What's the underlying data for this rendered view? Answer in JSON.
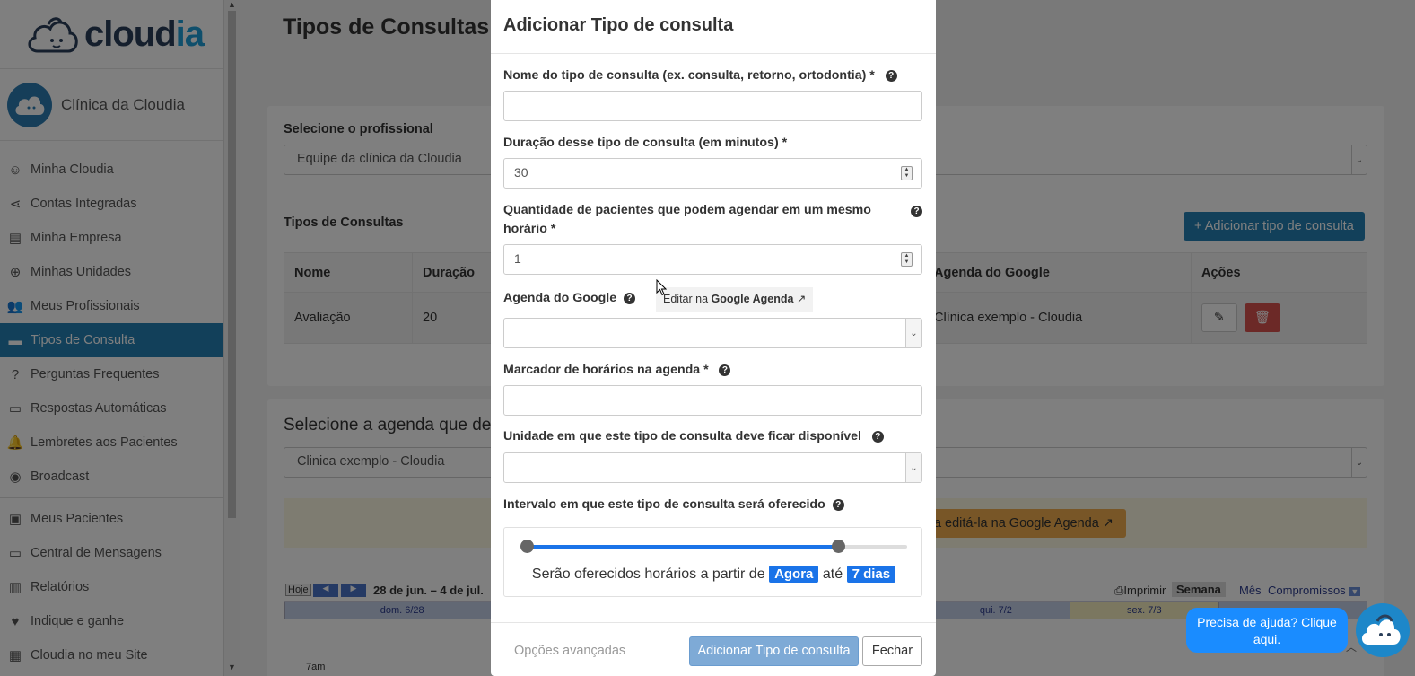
{
  "brand": {
    "name_a": "cloud",
    "name_b": "ia"
  },
  "clinic": {
    "name": "Clínica da Cloudia"
  },
  "sidebar": {
    "items": [
      {
        "label": "Minha Cloudia",
        "icon": "face-icon"
      },
      {
        "label": "Contas Integradas",
        "icon": "share-icon"
      },
      {
        "label": "Minha Empresa",
        "icon": "store-icon"
      },
      {
        "label": "Minhas Unidades",
        "icon": "plus-circle-icon"
      },
      {
        "label": "Meus Profissionais",
        "icon": "people-icon"
      },
      {
        "label": "Tipos de Consulta",
        "icon": "list-icon"
      },
      {
        "label": "Perguntas Frequentes",
        "icon": "question-icon"
      },
      {
        "label": "Respostas Automáticas",
        "icon": "chat-icon"
      },
      {
        "label": "Lembretes aos Pacientes",
        "icon": "bell-icon"
      },
      {
        "label": "Broadcast",
        "icon": "broadcast-icon"
      },
      {
        "label": "Meus Pacientes",
        "icon": "contacts-icon"
      },
      {
        "label": "Central de Mensagens",
        "icon": "message-icon"
      },
      {
        "label": "Relatórios",
        "icon": "bar-chart-icon"
      },
      {
        "label": "Indique e ganhe",
        "icon": "heart-icon"
      },
      {
        "label": "Cloudia no meu Site",
        "icon": "widgets-icon"
      }
    ]
  },
  "main": {
    "title": "Tipos de Consultas",
    "select_professional_label": "Selecione o profissional",
    "select_professional_value": "Equipe da clínica da Cloudia",
    "types_label": "Tipos de Consultas",
    "add_type_button": "Adicionar tipo de consulta",
    "table": {
      "headers": [
        "Nome",
        "Duração",
        "Agenda do Google",
        "Ações"
      ],
      "rows": [
        {
          "nome": "Avaliação",
          "duracao": "20",
          "agenda": "Clínica exemplo - Cloudia"
        }
      ]
    },
    "select_agenda_label": "Selecione a agenda que dese",
    "select_agenda_value": "Clinica exemplo - Cloudia",
    "warn_button": "para editá-la na Google Agenda",
    "calendar": {
      "today": "Hoje",
      "range": "28 de jun. – 4 de jul.",
      "print": "Imprimir",
      "week": "Semana",
      "month": "Mês",
      "appointments": "Compromissos",
      "days": [
        "dom. 6/28",
        "",
        "",
        "",
        "qui. 7/2",
        "sex. 7/3",
        ""
      ],
      "time": "7am"
    }
  },
  "modal": {
    "title": "Adicionar Tipo de consulta",
    "name_label": "Nome do tipo de consulta (ex. consulta, retorno, ortodontia) *",
    "name_value": "",
    "duration_label": "Duração desse tipo de consulta (em minutos) *",
    "duration_value": "30",
    "quantity_label_1": "Quantidade de pacientes que podem agendar em um mesmo",
    "quantity_label_2": "horário *",
    "quantity_value": "1",
    "gcal_label": "Agenda do Google",
    "gcal_link_pre": "Editar na ",
    "gcal_link_bold": "Google Agenda",
    "gcal_value": "",
    "marker_label": "Marcador de horários na agenda *",
    "marker_value": "",
    "unit_label": "Unidade em que este tipo de consulta deve ficar disponível",
    "unit_value": "",
    "interval_label": "Intervalo em que este tipo de consulta será oferecido",
    "range_text_pre": "Serão oferecidos horários a partir de",
    "range_from": "Agora",
    "range_mid": "até",
    "range_to": "7 dias",
    "range_start_fraction": 0.0,
    "range_end_fraction": 0.82,
    "advanced": "Opções avançadas",
    "submit": "Adicionar Tipo de consulta",
    "close": "Fechar"
  },
  "help": {
    "text": "Precisa de ajuda? Clique aqui."
  },
  "colors": {
    "accent": "#2581b5",
    "slider": "#1a73e8",
    "danger": "#d9534f",
    "help": "#1a8cff"
  }
}
